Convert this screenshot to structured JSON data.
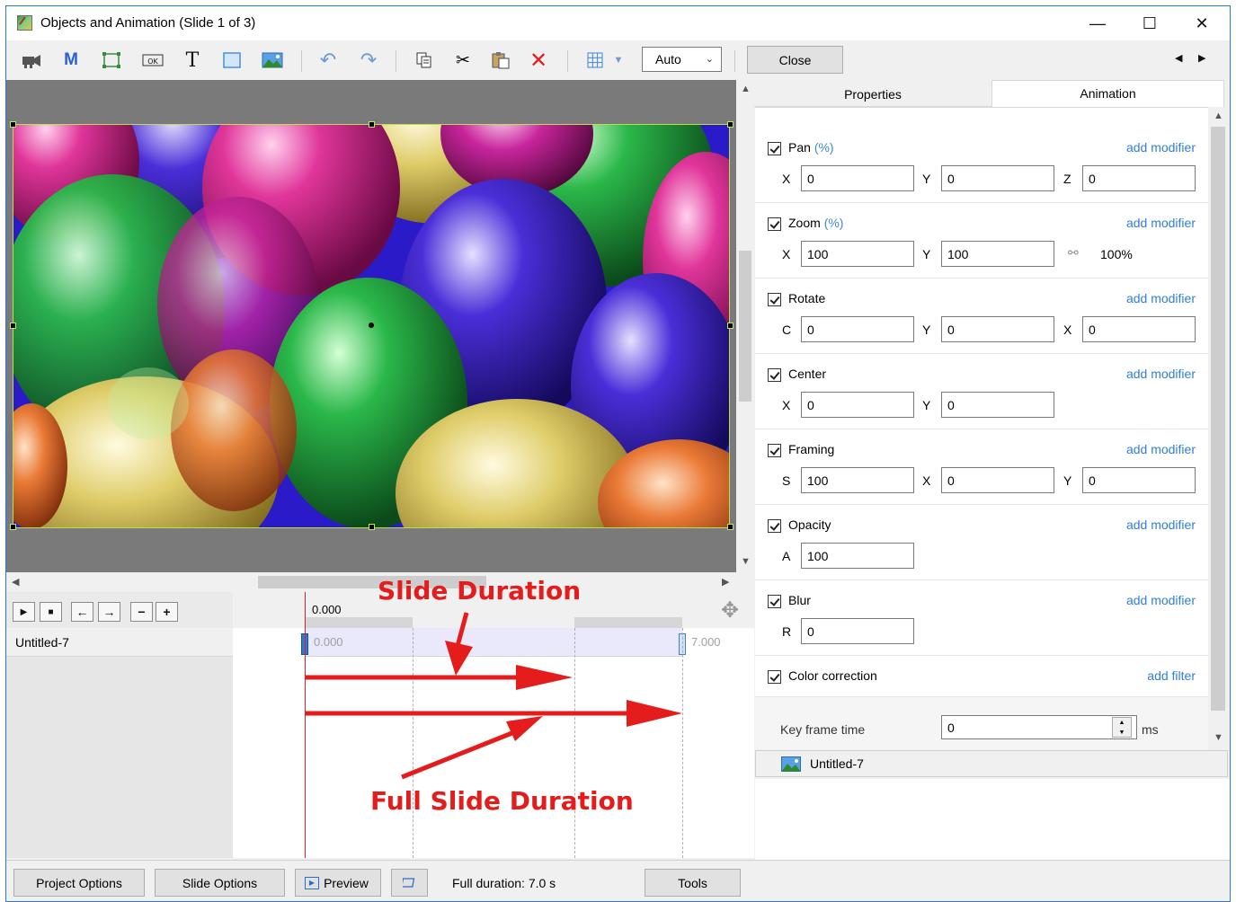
{
  "window": {
    "title": "Objects and Animation (Slide 1 of 3)",
    "controls": {
      "minimize": "—",
      "maximize": "☐",
      "close": "✕"
    }
  },
  "toolbar": {
    "zoom_select": "Auto",
    "close_label": "Close",
    "icons": [
      "camera-icon",
      "m-icon",
      "frame-icon",
      "ok-button-icon",
      "text-icon",
      "rectangle-icon",
      "image-icon",
      "undo-icon",
      "redo-icon",
      "copy-icon",
      "cut-icon",
      "paste-icon",
      "delete-icon",
      "grid-icon"
    ]
  },
  "tabs": {
    "properties": "Properties",
    "animation": "Animation"
  },
  "animation": {
    "pan": {
      "title": "Pan",
      "unit": "(%)",
      "add": "add modifier",
      "fields": [
        {
          "label": "X",
          "value": "0"
        },
        {
          "label": "Y",
          "value": "0"
        },
        {
          "label": "Z",
          "value": "0"
        }
      ]
    },
    "zoom": {
      "title": "Zoom",
      "unit": "(%)",
      "add": "add modifier",
      "fields": [
        {
          "label": "X",
          "value": "100"
        },
        {
          "label": "Y",
          "value": "100"
        }
      ],
      "lock_value": "100%"
    },
    "rotate": {
      "title": "Rotate",
      "add": "add modifier",
      "fields": [
        {
          "label": "C",
          "value": "0"
        },
        {
          "label": "Y",
          "value": "0"
        },
        {
          "label": "X",
          "value": "0"
        }
      ]
    },
    "center": {
      "title": "Center",
      "add": "add modifier",
      "fields": [
        {
          "label": "X",
          "value": "0"
        },
        {
          "label": "Y",
          "value": "0"
        }
      ]
    },
    "framing": {
      "title": "Framing",
      "add": "add modifier",
      "fields": [
        {
          "label": "S",
          "value": "100"
        },
        {
          "label": "X",
          "value": "0"
        },
        {
          "label": "Y",
          "value": "0"
        }
      ]
    },
    "opacity": {
      "title": "Opacity",
      "add": "add modifier",
      "fields": [
        {
          "label": "A",
          "value": "100"
        }
      ]
    },
    "blur": {
      "title": "Blur",
      "add": "add modifier",
      "fields": [
        {
          "label": "R",
          "value": "0"
        }
      ]
    },
    "color": {
      "title": "Color correction",
      "add": "add filter"
    },
    "keyframe": {
      "label": "Key frame time",
      "value": "0",
      "unit": "ms"
    }
  },
  "object_list": {
    "item": "Untitled-7"
  },
  "timeline": {
    "ruler_start": "0.000",
    "track_name": "Untitled-7",
    "track_start": "0.000",
    "track_end": "7.000"
  },
  "annotations": {
    "slide_duration": "Slide Duration",
    "full_slide_duration": "Full Slide Duration",
    "color": "#e41c1c"
  },
  "bottombar": {
    "project_options": "Project Options",
    "slide_options": "Slide Options",
    "preview": "Preview",
    "full_duration": "Full duration: 7.0 s",
    "tools": "Tools"
  }
}
